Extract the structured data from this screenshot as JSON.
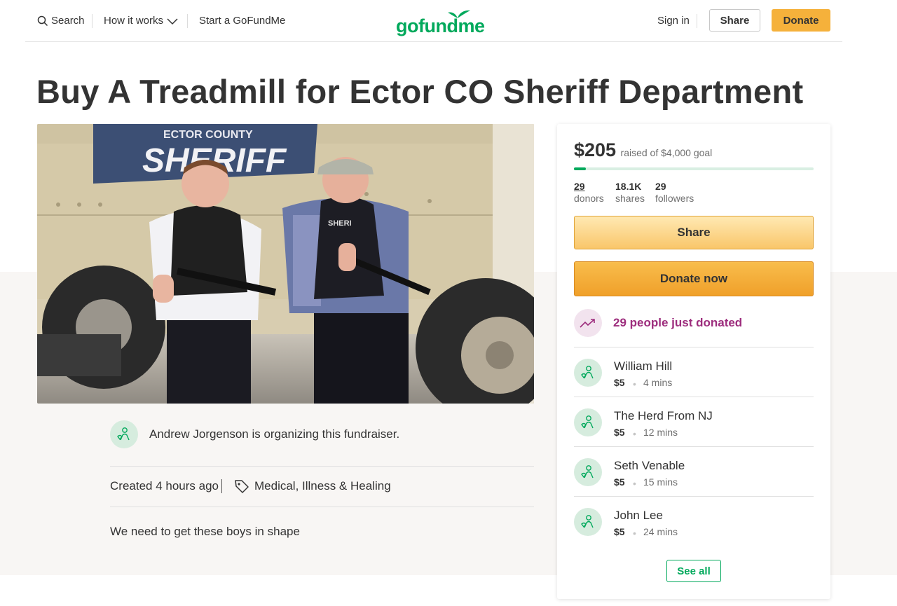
{
  "header": {
    "search_label": "Search",
    "how_it_works_label": "How it works",
    "start_label": "Start a GoFundMe",
    "logo_text": "gofundme",
    "sign_in_label": "Sign in",
    "share_label": "Share",
    "donate_label": "Donate"
  },
  "campaign": {
    "title": "Buy A Treadmill for Ector CO Sheriff Department",
    "organizer_text": "Andrew Jorgenson is organizing this fundraiser.",
    "created": "Created 4 hours ago",
    "category": "Medical, Illness & Healing",
    "description": "We need to get these boys in shape",
    "image_text": {
      "vehicle_line1": "ECTOR COUNTY",
      "vehicle_line2": "SHERIFF",
      "vest_text": "SHERI"
    }
  },
  "card": {
    "raised_amount": "$205",
    "raised_goal_text": "raised of $4,000 goal",
    "progress_fraction": 0.051,
    "stats": [
      {
        "number": "29",
        "label": "donors"
      },
      {
        "number": "18.1K",
        "label": "shares"
      },
      {
        "number": "29",
        "label": "followers"
      }
    ],
    "share_label": "Share",
    "donate_label": "Donate now",
    "recent_text": "29 people just donated",
    "donations": [
      {
        "name": "William Hill",
        "amount": "$5",
        "time": "4 mins"
      },
      {
        "name": "The Herd From NJ",
        "amount": "$5",
        "time": "12 mins"
      },
      {
        "name": "Seth Venable",
        "amount": "$5",
        "time": "15 mins"
      },
      {
        "name": "John Lee",
        "amount": "$5",
        "time": "24 mins"
      }
    ],
    "see_all_label": "See all"
  },
  "colors": {
    "brand_green": "#02a95c",
    "donate_orange": "#f5b13b",
    "recent_purple": "#9d2d7d"
  },
  "icons": [
    "search-icon",
    "chevron-down-icon",
    "tag-icon",
    "trending-up-icon",
    "person-heart-icon"
  ]
}
